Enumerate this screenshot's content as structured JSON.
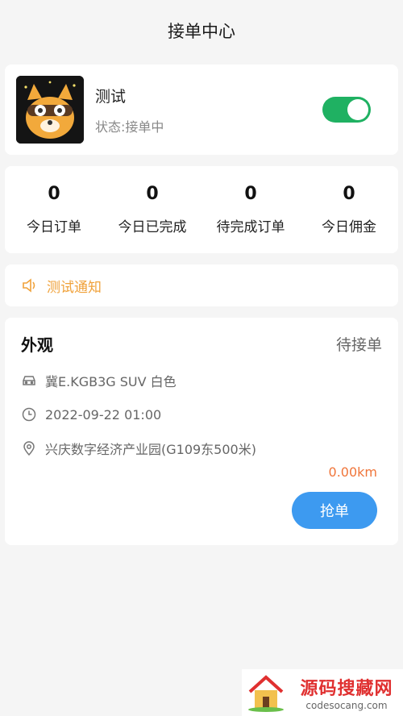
{
  "header": {
    "title": "接单中心"
  },
  "profile": {
    "name": "测试",
    "status": "状态:接单中",
    "toggle_on": true,
    "toggle_color": "#1fb162"
  },
  "stats": [
    {
      "value": "0",
      "label": "今日订单"
    },
    {
      "value": "0",
      "label": "今日已完成"
    },
    {
      "value": "0",
      "label": "待完成订单"
    },
    {
      "value": "0",
      "label": "今日佣金"
    }
  ],
  "notice": {
    "text": "测试通知",
    "color": "#f0a23b"
  },
  "order": {
    "title": "外观",
    "status": "待接单",
    "vehicle": "冀E.KGB3G SUV 白色",
    "time": "2022-09-22 01:00",
    "address": "兴庆数字经济产业园(G109东500米)",
    "distance": "0.00km",
    "grab_label": "抢单"
  },
  "watermark": {
    "title": "源码搜藏网",
    "url": "codesocang.com"
  }
}
